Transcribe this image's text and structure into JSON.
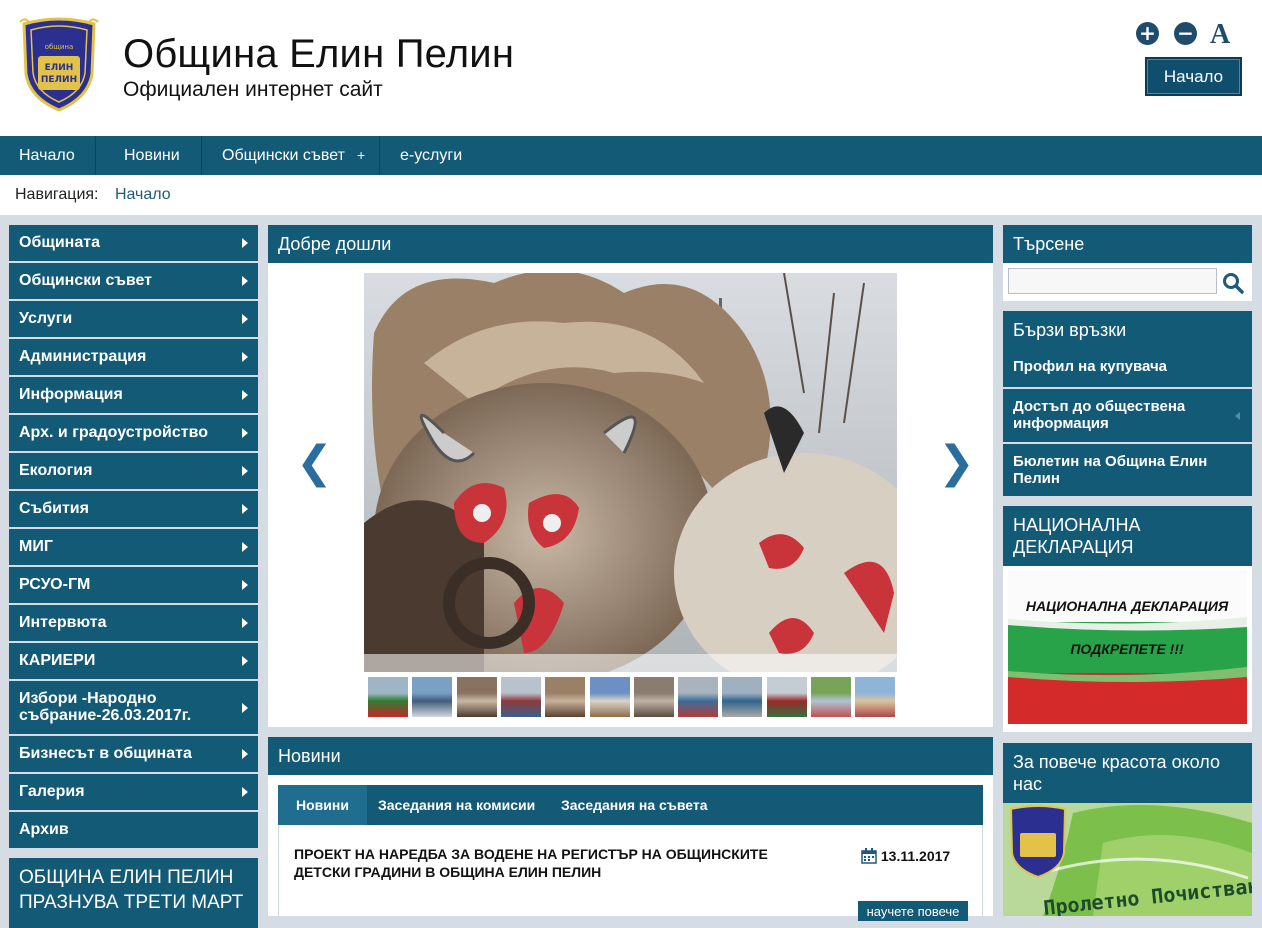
{
  "header": {
    "title": "Община Елин Пелин",
    "subtitle": "Официален интернет сайт",
    "home_button": "Начало",
    "font_increase": "+",
    "font_decrease": "−",
    "font_reset": "A",
    "logo_text": [
      "община",
      "ЕЛИН",
      "ПЕЛИН"
    ]
  },
  "topnav": {
    "items": [
      {
        "label": "Начало"
      },
      {
        "label": "Новини"
      },
      {
        "label": "Общински съвет",
        "expand": "+"
      },
      {
        "label": "е-услуги"
      }
    ]
  },
  "breadcrumb": {
    "label": "Навигация:",
    "current": "Начало"
  },
  "sidebar": {
    "items": [
      {
        "label": "Общината",
        "submenu": true
      },
      {
        "label": "Общински съвет",
        "submenu": true
      },
      {
        "label": "Услуги",
        "submenu": true
      },
      {
        "label": "Администрация",
        "submenu": true
      },
      {
        "label": "Информация",
        "submenu": true
      },
      {
        "label": "Арх. и градоустройство",
        "submenu": true
      },
      {
        "label": "Екология",
        "submenu": true
      },
      {
        "label": "Събития",
        "submenu": true
      },
      {
        "label": "МИГ",
        "submenu": true
      },
      {
        "label": "РСУО-ГМ",
        "submenu": true
      },
      {
        "label": "Интервюта",
        "submenu": true
      },
      {
        "label": "КАРИЕРИ",
        "submenu": true
      },
      {
        "label": "Избори -Народно събрание-26.03.2017г.",
        "submenu": true
      },
      {
        "label": "Бизнесът в общината",
        "submenu": true
      },
      {
        "label": "Галерия",
        "submenu": true
      },
      {
        "label": "Архив",
        "submenu": false
      }
    ],
    "feature_title": "ОБЩИНА ЕЛИН ПЕЛИН ПРАЗНУВА ТРЕТИ МАРТ"
  },
  "welcome": {
    "title": "Добре дошли",
    "prev_arrow": "❮",
    "next_arrow": "❯",
    "thumbnail_count": 12
  },
  "news": {
    "title": "Новини",
    "tabs": [
      "Новини",
      "Заседания на комисии",
      "Заседания на съвета"
    ],
    "active_tab": 0,
    "items": [
      {
        "title": "ПРОЕКТ НА НАРЕДБА ЗА ВОДЕНЕ НА РЕГИСТЪР НА ОБЩИНСКИТЕ ДЕТСКИ ГРАДИНИ В ОБЩИНА ЕЛИН ПЕЛИН",
        "date": "13.11.2017",
        "more": "научете повече"
      }
    ]
  },
  "search": {
    "title": "Търсене",
    "value": "",
    "placeholder": ""
  },
  "quick_links": {
    "title": "Бързи връзки",
    "items": [
      "Профил на купувача",
      "Достъп до обществена информация",
      "Бюлетин на Община Елин Пелин"
    ]
  },
  "declaration": {
    "title": "НАЦИОНАЛНА ДЕКЛАРАЦИЯ",
    "banner_line1": "НАЦИОНАЛНА ДЕКЛАРАЦИЯ",
    "banner_line2": "ПОДКРЕПЕТЕ !!!"
  },
  "beauty": {
    "title": "За повече красота около нас",
    "banner_text": "Пролетно Почистване"
  },
  "colors": {
    "primary": "#135a76",
    "background": "#d5dce4",
    "accent": "#2a6ea0"
  }
}
